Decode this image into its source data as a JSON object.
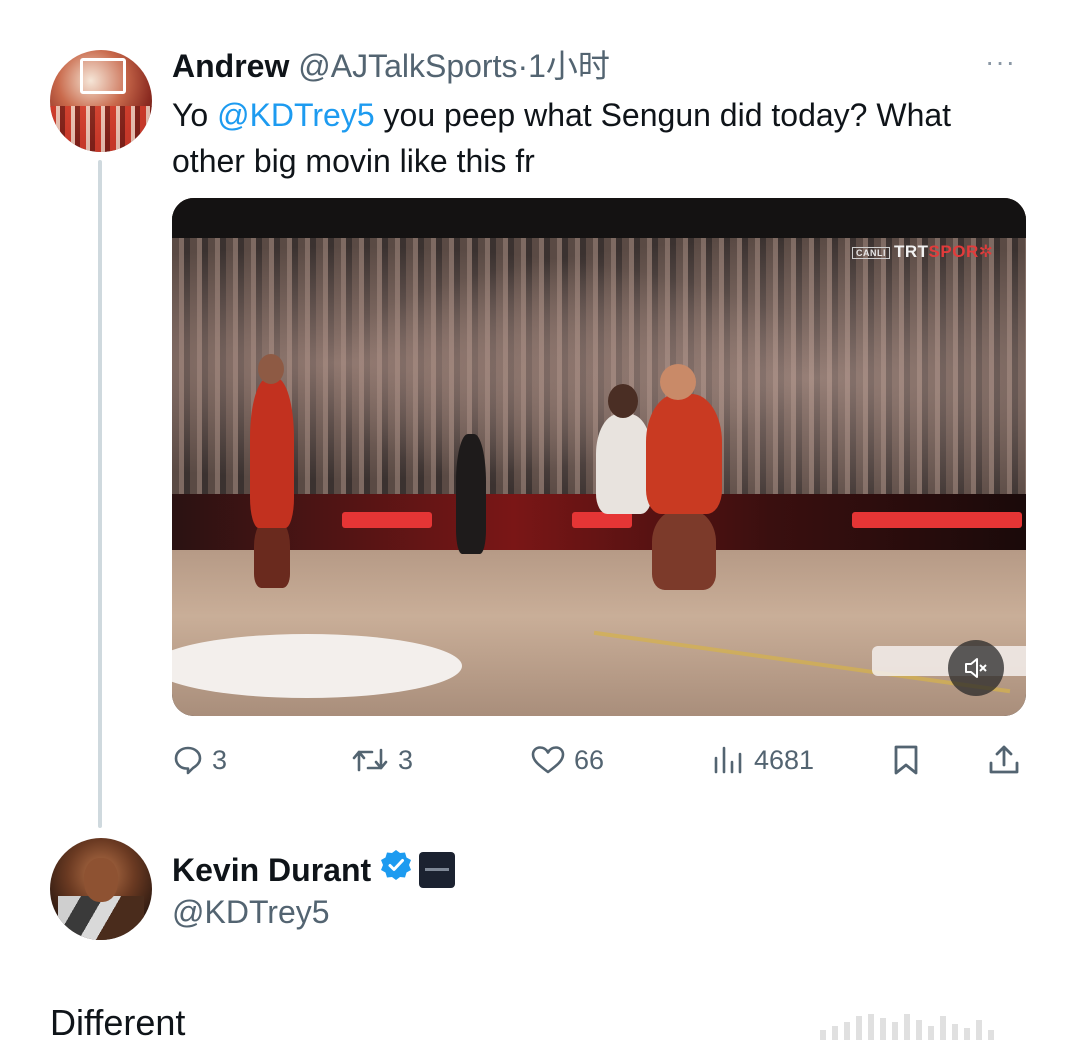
{
  "tweet": {
    "author_name": "Andrew",
    "author_handle": "@AJTalkSports",
    "separator": "·",
    "time": "1小时",
    "text_before": "Yo ",
    "mention": "@KDTrey5",
    "text_after": " you peep what Sengun did today? What other big movin like this fr",
    "media": {
      "watermark_tag": "CANLI",
      "watermark_trt": "TRT",
      "watermark_spor": "SPOR"
    },
    "stats": {
      "replies": "3",
      "retweets": "3",
      "likes": "66",
      "views": "4681"
    }
  },
  "reply": {
    "author_name": "Kevin Durant",
    "author_handle": "@KDTrey5",
    "text": "Different"
  },
  "colors": {
    "link": "#1d9bf0",
    "verified": "#1d9bf0",
    "secondary_text": "#536471"
  },
  "icons": [
    "more-icon",
    "reply-icon",
    "retweet-icon",
    "like-icon",
    "views-icon",
    "bookmark-icon",
    "share-icon",
    "mute-icon",
    "verified-icon"
  ]
}
